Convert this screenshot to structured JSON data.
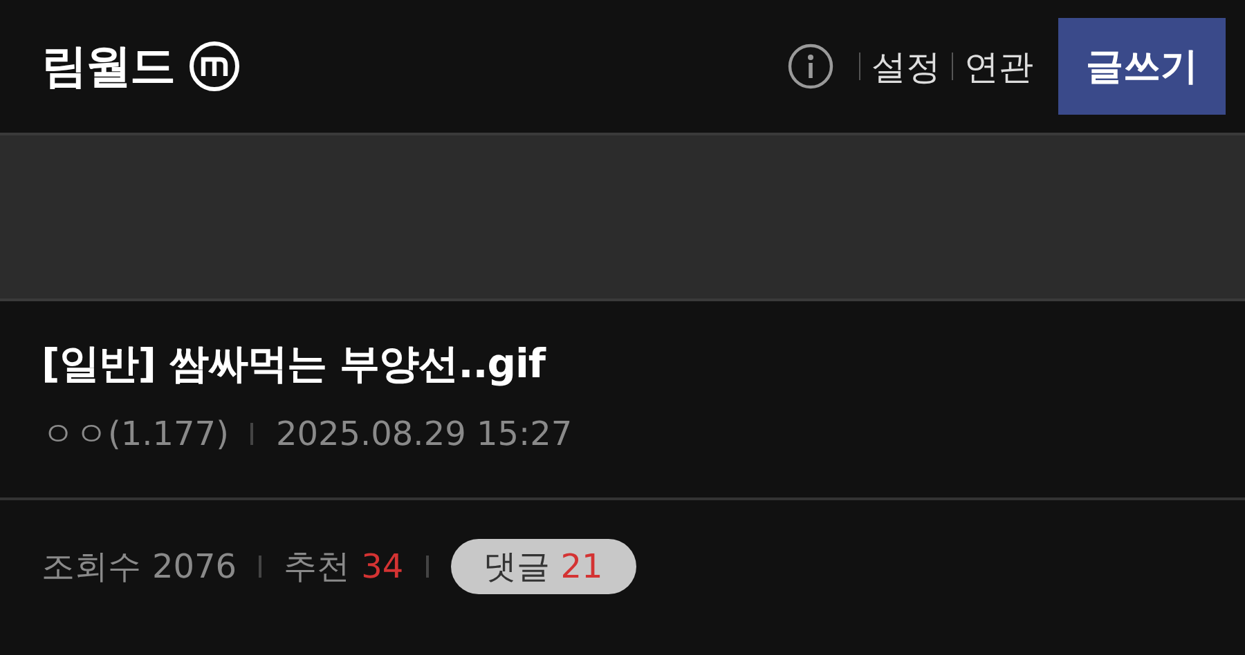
{
  "header": {
    "logo": "림월드",
    "links": [
      "설정",
      "연관"
    ],
    "write_button": "글쓰기"
  },
  "post": {
    "category": "[일반]",
    "title": "쌈싸먹는 부양선..gif",
    "author": "ㅇㅇ(1.177)",
    "date": "2025.08.29 15:27"
  },
  "stats": [
    {
      "kind": "text",
      "label": "조회수",
      "value": "2076",
      "highlighted": false
    },
    {
      "kind": "text",
      "label": "추천",
      "value": "34",
      "highlighted": true
    },
    {
      "kind": "pill",
      "label": "댓글",
      "value": "21",
      "highlighted": true
    }
  ]
}
